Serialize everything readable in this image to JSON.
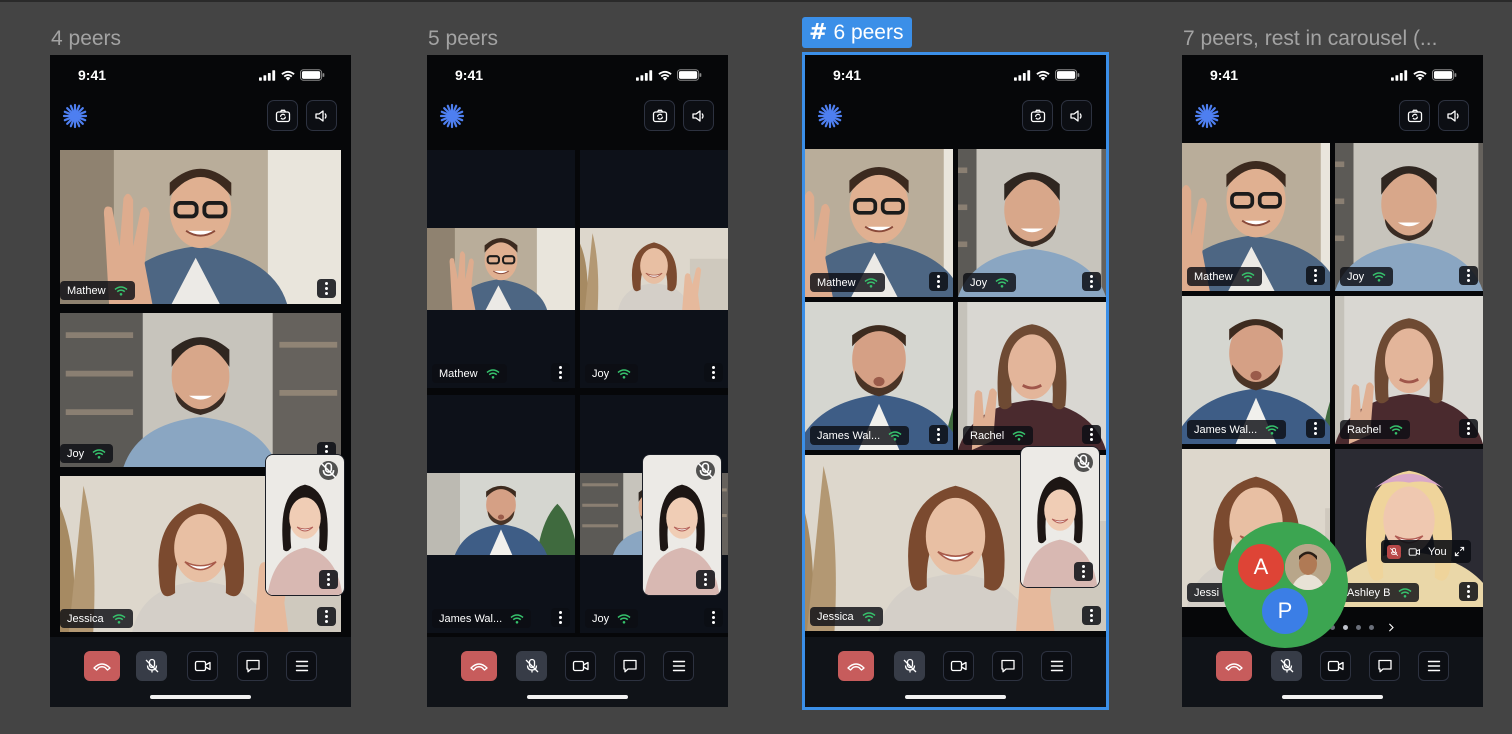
{
  "frames": [
    {
      "label": "4 peers",
      "selected": false
    },
    {
      "label": "5 peers",
      "selected": false
    },
    {
      "label": "6 peers",
      "selected": true
    },
    {
      "label": "7 peers, rest in carousel (..."
    }
  ],
  "status_bar": {
    "time": "9:41"
  },
  "header": {
    "logo_icon": "asterisk-logo-icon",
    "buttons": [
      "switch-camera-icon",
      "speaker-icon"
    ],
    "accent_color": "#4e7ff0"
  },
  "peers": {
    "mathew": "Mathew",
    "joy": "Joy",
    "jessica": "Jessica",
    "james": "James Wal...",
    "rachel": "Rachel",
    "jessica_short": "Jessi",
    "ashley": "Ashley B",
    "you": "You"
  },
  "avatars": {
    "a": "A",
    "p": "P"
  },
  "controls": [
    {
      "icon": "leave-call-icon"
    },
    {
      "icon": "mic-off-icon"
    },
    {
      "icon": "video-camera-icon"
    },
    {
      "icon": "chat-icon"
    },
    {
      "icon": "menu-icon"
    }
  ],
  "colors": {
    "selection": "#3b8fe8",
    "leave": "#c75c5c",
    "connection_good": "#36c26c",
    "avatar_cluster": "#3ca551",
    "avatar_a": "#de4436",
    "avatar_p": "#3b7ee6"
  }
}
